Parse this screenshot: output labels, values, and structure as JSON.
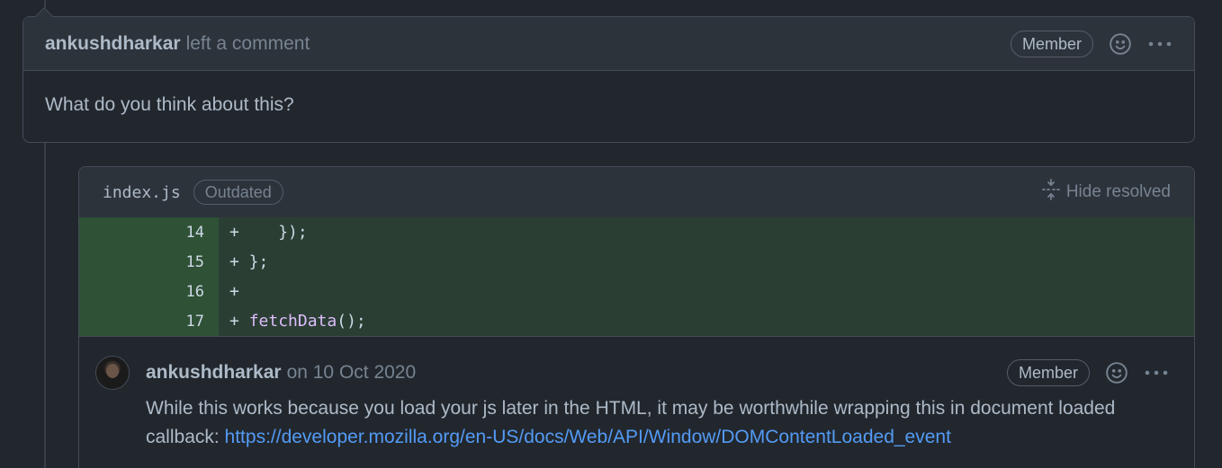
{
  "comment": {
    "author": "ankushdharkar",
    "action": "left a comment",
    "badge": "Member",
    "icons": [
      "smiley-icon",
      "kebab-menu-icon"
    ],
    "body": "What do you think about this?"
  },
  "review": {
    "filename": "index.js",
    "status_badge": "Outdated",
    "hide_resolved_label": "Hide resolved",
    "diff_lines": [
      {
        "num": "14",
        "prefix": "+",
        "code": "    });"
      },
      {
        "num": "15",
        "prefix": "+",
        "code": " };"
      },
      {
        "num": "16",
        "prefix": "+",
        "code": ""
      },
      {
        "num": "17",
        "prefix": "+",
        "code_fn": "fetchData",
        "code_rest": "();"
      }
    ],
    "reply": {
      "author": "ankushdharkar",
      "date": "on 10 Oct 2020",
      "badge": "Member",
      "body_text": "While this works because you load your js later in the HTML, it may be worthwhile wrapping this in document loaded callback: ",
      "link": "https://developer.mozilla.org/en-US/docs/Web/API/Window/DOMContentLoaded_event"
    }
  },
  "colors": {
    "background": "#22272e",
    "header_bg": "#2d333b",
    "diff_added_bg": "#2b3e34",
    "link": "#539bf5"
  }
}
